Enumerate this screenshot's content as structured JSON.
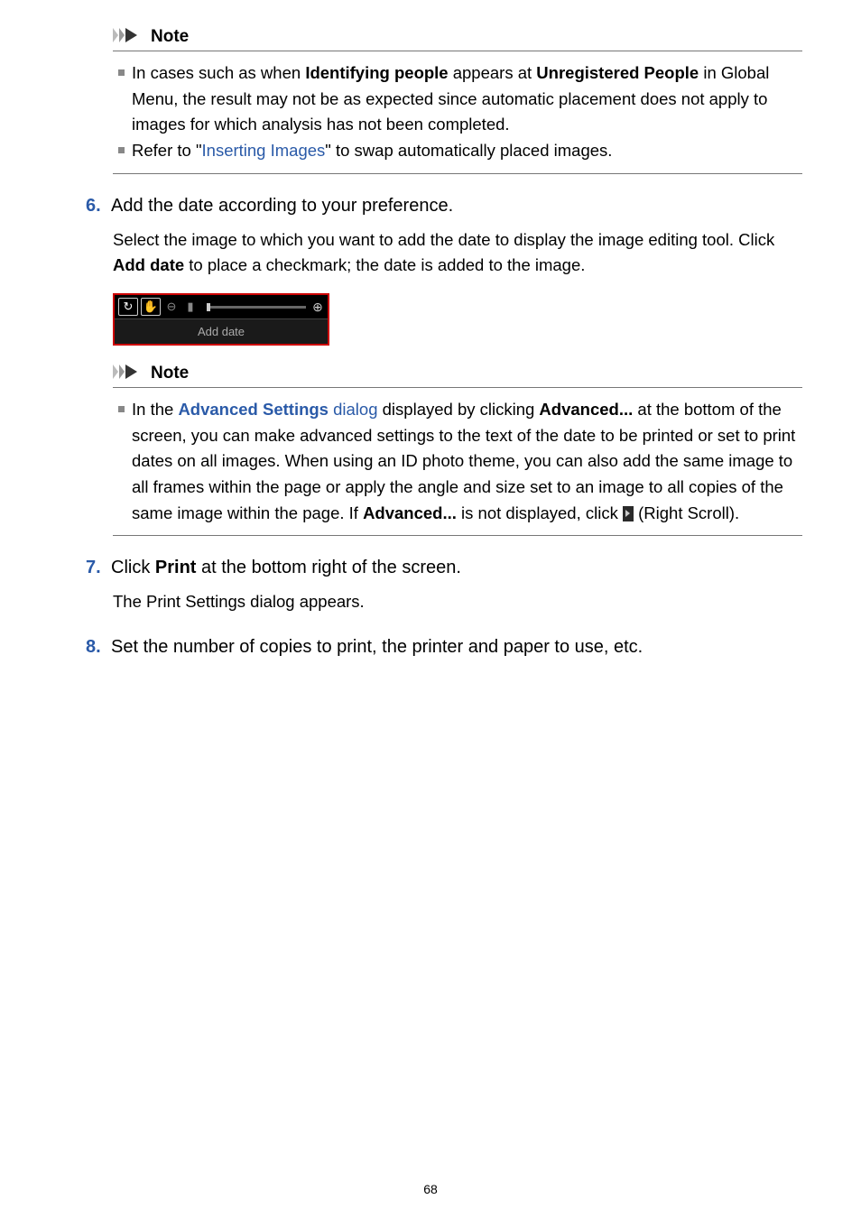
{
  "note1": {
    "heading": "Note",
    "bullet1_a": "In cases such as when ",
    "bullet1_b": "Identifying people",
    "bullet1_c": " appears at ",
    "bullet1_d": "Unregistered People",
    "bullet1_e": " in Global Menu, the result may not be as expected since automatic placement does not apply to images for which analysis has not been completed.",
    "bullet2_a": "Refer to \"",
    "bullet2_link": "Inserting Images",
    "bullet2_b": "\" to swap automatically placed images."
  },
  "step6": {
    "num": "6.",
    "title": "Add the date according to your preference.",
    "body_a": "Select the image to which you want to add the date to display the image editing tool. Click ",
    "body_b": "Add date",
    "body_c": " to place a checkmark; the date is added to the image."
  },
  "toolbar": {
    "add_date": "Add date"
  },
  "note2": {
    "heading": "Note",
    "t1": "In the ",
    "link1a": "Advanced Settings",
    "link1b": " dialog",
    "t2": " displayed by clicking ",
    "b1": "Advanced...",
    "t3": " at the bottom of the screen, you can make advanced settings to the text of the date to be printed or set to print dates on all images. When using an ID photo theme, you can also add the same image to all frames within the page or apply the angle and size set to an image to all copies of the same image within the page. If ",
    "b2": "Advanced...",
    "t4": " is not displayed, click ",
    "t5": " (Right Scroll)."
  },
  "step7": {
    "num": "7.",
    "title_a": "Click ",
    "title_b": "Print",
    "title_c": " at the bottom right of the screen.",
    "body": "The Print Settings dialog appears."
  },
  "step8": {
    "num": "8.",
    "title": "Set the number of copies to print, the printer and paper to use, etc."
  },
  "page_number": "68"
}
